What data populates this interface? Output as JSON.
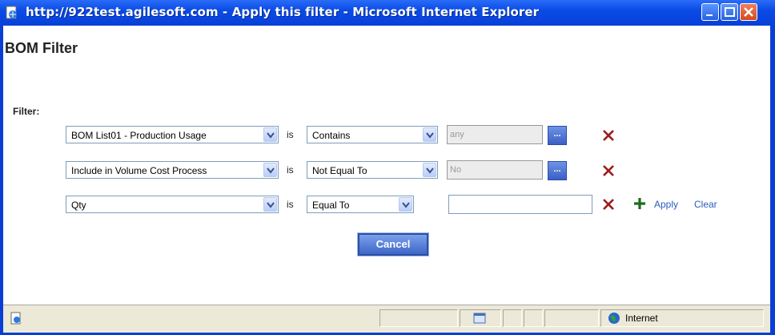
{
  "window": {
    "title": "http://922test.agilesoft.com - Apply this filter - Microsoft Internet Explorer",
    "icon": "ie-page-icon"
  },
  "page": {
    "title": "BOM Filter"
  },
  "filter": {
    "label": "Filter:",
    "rows": [
      {
        "attribute": "BOM List01 - Production Usage",
        "is_label": "is",
        "operator": "Contains",
        "value": "any",
        "value_enabled": false,
        "has_browse": true,
        "browse_label": "..."
      },
      {
        "attribute": "Include in Volume Cost Process",
        "is_label": "is",
        "operator": "Not Equal To",
        "value": "No",
        "value_enabled": false,
        "has_browse": true,
        "browse_label": "..."
      },
      {
        "attribute": "Qty",
        "is_label": "is",
        "operator": "Equal To",
        "value": "",
        "value_enabled": true,
        "has_browse": false
      }
    ],
    "apply_label": "Apply",
    "clear_label": "Clear",
    "cancel_label": "Cancel"
  },
  "statusbar": {
    "zone": "Internet"
  },
  "colors": {
    "titlebar": "#0a4be6",
    "delete_icon": "#9b1c1c",
    "add_icon": "#1e6b1e",
    "link": "#2b5bbf",
    "button": "#3e67c8"
  }
}
